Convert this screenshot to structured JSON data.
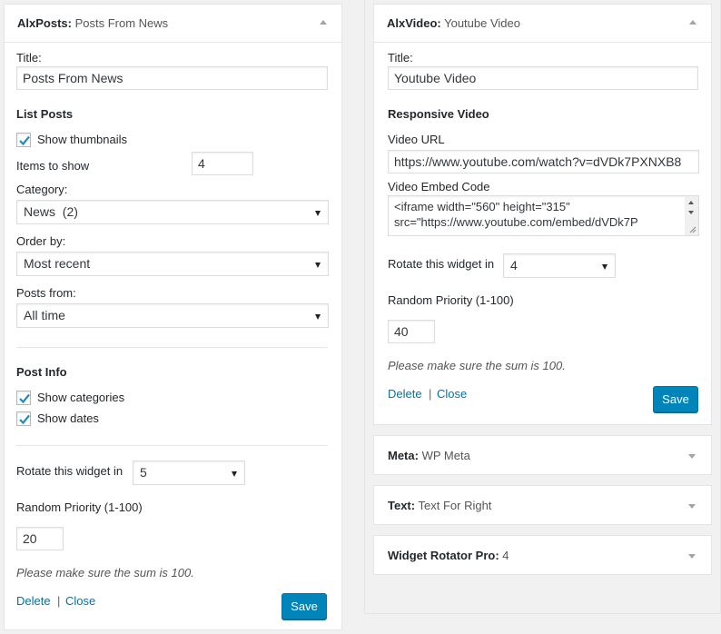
{
  "left_widget": {
    "title_bold": "AlxPosts:",
    "title_sub": "Posts From News",
    "title_label": "Title:",
    "title_value": "Posts From News",
    "list_posts_heading": "List Posts",
    "show_thumbnails_label": "Show thumbnails",
    "show_thumbnails_checked": true,
    "items_label": "Items to show",
    "items_value": "4",
    "category_label": "Category:",
    "category_value": "News  (2)",
    "order_label": "Order by:",
    "order_value": "Most recent",
    "posts_from_label": "Posts from:",
    "posts_from_value": "All time",
    "post_info_heading": "Post Info",
    "show_categories_label": "Show categories",
    "show_categories_checked": true,
    "show_dates_label": "Show dates",
    "show_dates_checked": true,
    "rotate_label": "Rotate this widget in",
    "rotate_value": "5",
    "priority_label": "Random Priority (1-100)",
    "priority_value": "20",
    "note": "Please make sure the sum is 100.",
    "delete_label": "Delete",
    "separator": "|",
    "close_label": "Close",
    "save_label": "Save"
  },
  "right_widget": {
    "title_bold": "AlxVideo:",
    "title_sub": "Youtube Video",
    "title_label": "Title:",
    "title_value": "Youtube Video",
    "responsive_heading": "Responsive Video",
    "video_url_label": "Video URL",
    "video_url_value": "https://www.youtube.com/watch?v=dVDk7PXNXB8",
    "embed_label": "Video Embed Code",
    "embed_line1": "<iframe width=\"560\" height=\"315\"",
    "embed_line2": "src=\"https://www.youtube.com/embed/dVDk7P",
    "rotate_label": "Rotate this widget in",
    "rotate_value": "4",
    "priority_label": "Random Priority (1-100)",
    "priority_value": "40",
    "note": "Please make sure the sum is 100.",
    "delete_label": "Delete",
    "separator": "|",
    "close_label": "Close",
    "save_label": "Save"
  },
  "collapsed_widgets": [
    {
      "bold": "Meta:",
      "sub": "WP Meta"
    },
    {
      "bold": "Text:",
      "sub": "Text For Right"
    },
    {
      "bold": "Widget Rotator Pro:",
      "sub": "4"
    }
  ],
  "colors": {
    "primary_button": "#0085ba",
    "link": "#0073aa",
    "checkmark": "#1e8cbe",
    "border": "#e5e5e5"
  },
  "icons": {
    "collapse": "arrow-up-icon",
    "expand": "arrow-down-icon",
    "dropdown": "caret-down-icon",
    "checkbox": "checkmark-icon"
  }
}
